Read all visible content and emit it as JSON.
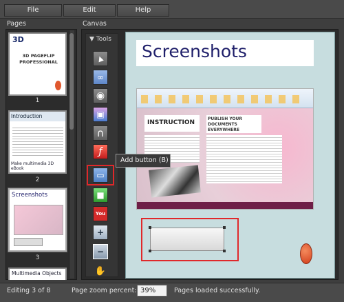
{
  "menu": {
    "file": "File",
    "edit": "Edit",
    "help": "Help"
  },
  "panels": {
    "pages_header": "Pages",
    "canvas_header": "Canvas",
    "tools_header": "Tools"
  },
  "pages": [
    {
      "number": "1",
      "title": "3D PAGEFLIP PROFESSIONAL",
      "logo": "3D"
    },
    {
      "number": "2",
      "title": "Introduction",
      "subtitle": "Make multimedia 3D eBook"
    },
    {
      "number": "3",
      "title": "Screenshots"
    },
    {
      "number": "",
      "title": "Multimedia Objects"
    }
  ],
  "canvas": {
    "page_title": "Screenshots",
    "embedded": {
      "heading_left": "INSTRUCTION",
      "heading_right": "PUBLISH YOUR DOCUMENTS EVERYWHERE"
    }
  },
  "tools": [
    {
      "name": "select-tool",
      "icon": "arrow-icon",
      "glyph": "▲"
    },
    {
      "name": "link-tool",
      "icon": "link-icon",
      "glyph": "∞"
    },
    {
      "name": "video-tool",
      "icon": "film-reel-icon",
      "glyph": "◉"
    },
    {
      "name": "image-tool",
      "icon": "picture-icon",
      "glyph": "▣"
    },
    {
      "name": "audio-tool",
      "icon": "headphones-icon",
      "glyph": "∩"
    },
    {
      "name": "flash-tool",
      "icon": "flash-icon",
      "glyph": "ƒ"
    },
    {
      "name": "add-button-tool",
      "icon": "button-icon",
      "glyph": "▭"
    },
    {
      "name": "shape-tool",
      "icon": "green-square-icon",
      "glyph": "■"
    },
    {
      "name": "youtube-tool",
      "icon": "youtube-icon",
      "glyph": "You"
    },
    {
      "name": "zoom-in-tool",
      "icon": "zoom-in-icon",
      "glyph": "+"
    },
    {
      "name": "zoom-out-tool",
      "icon": "zoom-out-icon",
      "glyph": "−"
    },
    {
      "name": "pan-tool",
      "icon": "hand-icon",
      "glyph": "✋"
    }
  ],
  "tooltip": "Add button (B)",
  "status": {
    "editing": "Editing 3 of 8",
    "zoom_label": "Page zoom percent:",
    "zoom_value": "39%",
    "message": "Pages loaded successfully."
  },
  "colors": {
    "accent_red": "#e0282a",
    "title_navy": "#1f1f6a",
    "canvas_bg": "#c7dddf"
  }
}
